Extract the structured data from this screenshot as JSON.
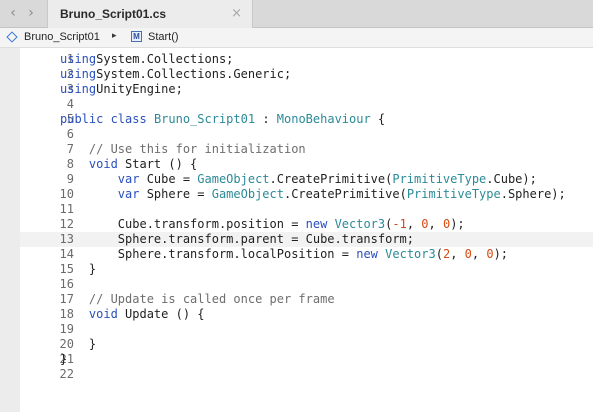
{
  "toolbar": {
    "back_glyph": "‹",
    "forward_glyph": "›"
  },
  "tab": {
    "title": "Bruno_Script01.cs",
    "close_glyph": "×"
  },
  "breadcrumb": {
    "class_name": "Bruno_Script01",
    "separator": "▸",
    "method_icon_letter": "M",
    "method_name": "Start()"
  },
  "editor": {
    "current_line": 13,
    "lines": [
      {
        "n": "1",
        "t": [
          [
            "kw",
            "using"
          ],
          [
            "",
            "System.Collections;"
          ]
        ]
      },
      {
        "n": "2",
        "t": [
          [
            "kw",
            "using"
          ],
          [
            "",
            "System.Collections.Generic;"
          ]
        ]
      },
      {
        "n": "3",
        "t": [
          [
            "kw",
            "using"
          ],
          [
            "",
            "UnityEngine;"
          ]
        ]
      },
      {
        "n": "4",
        "t": []
      },
      {
        "n": "5",
        "t": [
          [
            "kw",
            "public class"
          ],
          [
            "",
            " "
          ],
          [
            "ty",
            "Bruno_Script01"
          ],
          [
            "",
            " : "
          ],
          [
            "ty",
            "MonoBehaviour"
          ],
          [
            "",
            " {"
          ]
        ]
      },
      {
        "n": "6",
        "t": []
      },
      {
        "n": "7",
        "t": [
          [
            "",
            "    "
          ],
          [
            "cm",
            "// Use this for initialization"
          ]
        ]
      },
      {
        "n": "8",
        "t": [
          [
            "",
            "    "
          ],
          [
            "kw",
            "void"
          ],
          [
            "",
            " Start () {"
          ]
        ]
      },
      {
        "n": "9",
        "t": [
          [
            "",
            "        "
          ],
          [
            "kw",
            "var"
          ],
          [
            "",
            " Cube = "
          ],
          [
            "ty",
            "GameObject"
          ],
          [
            "",
            ".CreatePrimitive("
          ],
          [
            "ty",
            "PrimitiveType"
          ],
          [
            "",
            ".Cube);"
          ]
        ]
      },
      {
        "n": "10",
        "t": [
          [
            "",
            "        "
          ],
          [
            "kw",
            "var"
          ],
          [
            "",
            " Sphere = "
          ],
          [
            "ty",
            "GameObject"
          ],
          [
            "",
            ".CreatePrimitive("
          ],
          [
            "ty",
            "PrimitiveType"
          ],
          [
            "",
            ".Sphere);"
          ]
        ]
      },
      {
        "n": "11",
        "t": []
      },
      {
        "n": "12",
        "t": [
          [
            "",
            "        Cube.transform.position = "
          ],
          [
            "kw",
            "new"
          ],
          [
            "",
            " "
          ],
          [
            "ty",
            "Vector3"
          ],
          [
            "",
            "("
          ],
          [
            "num",
            "-1"
          ],
          [
            "",
            ", "
          ],
          [
            "num",
            "0"
          ],
          [
            "",
            ", "
          ],
          [
            "num",
            "0"
          ],
          [
            "",
            ");"
          ]
        ]
      },
      {
        "n": "13",
        "t": [
          [
            "",
            "        Sphere.transform.parent = Cube.transform;"
          ]
        ]
      },
      {
        "n": "14",
        "t": [
          [
            "",
            "        Sphere.transform.localPosition = "
          ],
          [
            "kw",
            "new"
          ],
          [
            "",
            " "
          ],
          [
            "ty",
            "Vector3"
          ],
          [
            "",
            "("
          ],
          [
            "num",
            "2"
          ],
          [
            "",
            ", "
          ],
          [
            "num",
            "0"
          ],
          [
            "",
            ", "
          ],
          [
            "num",
            "0"
          ],
          [
            "",
            ");"
          ]
        ]
      },
      {
        "n": "15",
        "t": [
          [
            "",
            "    }"
          ]
        ]
      },
      {
        "n": "16",
        "t": []
      },
      {
        "n": "17",
        "t": [
          [
            "",
            "    "
          ],
          [
            "cm",
            "// Update is called once per frame"
          ]
        ]
      },
      {
        "n": "18",
        "t": [
          [
            "",
            "    "
          ],
          [
            "kw",
            "void"
          ],
          [
            "",
            " Update () {"
          ]
        ]
      },
      {
        "n": "19",
        "t": []
      },
      {
        "n": "20",
        "t": [
          [
            "",
            "    }"
          ]
        ]
      },
      {
        "n": "21",
        "t": [
          [
            "",
            "}"
          ]
        ]
      },
      {
        "n": "22",
        "t": []
      }
    ]
  }
}
